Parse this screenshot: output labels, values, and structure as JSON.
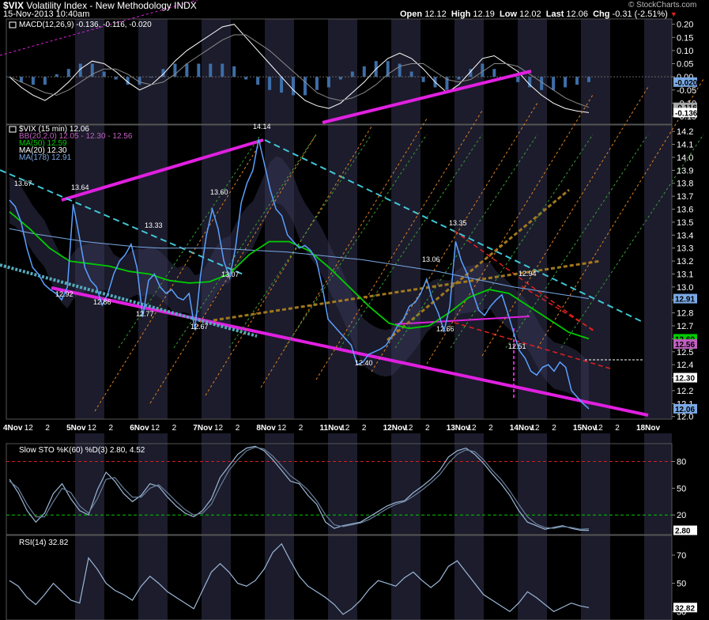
{
  "header": {
    "symbol": "$VIX",
    "name": "Volatility Index - New Methodology",
    "exchange": "INDX",
    "date": "15-Nov-2013 10:40am",
    "watermark": "© StockCharts.com",
    "open_label": "Open",
    "open": "12.12",
    "high_label": "High",
    "high": "12.19",
    "low_label": "Low",
    "low": "12.02",
    "last_label": "Last",
    "last": "12.06",
    "chg_label": "Chg",
    "chg": "-0.31 (-2.51%)"
  },
  "chart_data": [
    {
      "type": "line",
      "panel": "macd",
      "legend": "MACD(12,26,9) -0.136, -0.116, -0.020",
      "y_ticks": [
        "0.20",
        "0.15",
        "0.10",
        "0.05",
        "0.00",
        "-0.05",
        "-0.10",
        "-0.15"
      ],
      "ylim": [
        -0.18,
        0.22
      ],
      "last_tags": [
        {
          "value": -0.02,
          "label": "-0.020",
          "color": "#7aa9e6"
        },
        {
          "value": -0.116,
          "label": "-0.116",
          "color": "#aaaaaa"
        },
        {
          "value": -0.136,
          "label": "-0.136",
          "color": "#ffffff"
        }
      ],
      "series": [
        {
          "values": [
            0.0,
            -0.04,
            -0.07,
            -0.09,
            -0.06,
            -0.02,
            0.03,
            0.06,
            0.05,
            0.02,
            -0.02,
            -0.05,
            -0.03,
            0.01,
            0.06,
            0.1,
            0.13,
            0.16,
            0.19,
            0.2,
            0.15,
            0.1,
            0.05,
            0.0,
            -0.05,
            -0.09,
            -0.11,
            -0.12,
            -0.1,
            -0.06,
            -0.02,
            0.03,
            0.07,
            0.09,
            0.07,
            0.03,
            -0.02,
            -0.06,
            -0.03,
            0.02,
            0.07,
            0.08,
            0.05,
            0.02,
            -0.03,
            -0.07,
            -0.1,
            -0.12,
            -0.13,
            -0.136
          ],
          "color": "#ffffff"
        },
        {
          "values": [
            0.0,
            -0.02,
            -0.04,
            -0.06,
            -0.07,
            -0.05,
            -0.02,
            0.01,
            0.03,
            0.03,
            0.01,
            -0.02,
            -0.03,
            -0.02,
            0.01,
            0.05,
            0.08,
            0.11,
            0.14,
            0.16,
            0.16,
            0.13,
            0.1,
            0.06,
            0.02,
            -0.02,
            -0.06,
            -0.08,
            -0.09,
            -0.08,
            -0.06,
            -0.03,
            0.01,
            0.04,
            0.05,
            0.05,
            0.02,
            -0.01,
            -0.02,
            -0.01,
            0.02,
            0.05,
            0.05,
            0.04,
            0.01,
            -0.02,
            -0.05,
            -0.08,
            -0.1,
            -0.116
          ],
          "color": "#8a8a8a"
        }
      ]
    },
    {
      "type": "line",
      "panel": "price",
      "legend": [
        {
          "text": "$VIX (15 min) 12.06",
          "color": "#ffffff"
        },
        {
          "text": "BB(20,2.0) 12.05 - 12.30 - 12.56",
          "color": "#c060c0"
        },
        {
          "text": "MA(50) 12.59",
          "color": "#00cc00"
        },
        {
          "text": "MA(20) 12.30",
          "color": "#ffffff"
        },
        {
          "text": "MA(178) 12.91",
          "color": "#7aa9e6"
        }
      ],
      "y_ticks": [
        "14.2",
        "14.1",
        "14.0",
        "13.9",
        "13.8",
        "13.7",
        "13.6",
        "13.5",
        "13.4",
        "13.3",
        "13.2",
        "13.1",
        "13.0",
        "12.9",
        "12.8",
        "12.7",
        "12.6",
        "12.5",
        "12.4",
        "12.3",
        "12.2",
        "12.1",
        "12.0"
      ],
      "ylim": [
        11.98,
        14.25
      ],
      "last_tags": [
        {
          "value": 12.91,
          "label": "12.91",
          "color": "#7aa9e6"
        },
        {
          "value": 12.6,
          "label": "12.60",
          "color": "#00cc00"
        },
        {
          "value": 12.56,
          "label": "12.56",
          "color": "#c060c0"
        },
        {
          "value": 12.3,
          "label": "12.30",
          "color": "#ffffff"
        },
        {
          "value": 12.06,
          "label": "12.06",
          "color": "#7aa9e6"
        }
      ],
      "series": [
        {
          "name": "$VIX",
          "color": "#5aa0ff",
          "values": [
            13.67,
            13.62,
            13.5,
            13.3,
            13.15,
            13.1,
            13.02,
            12.98,
            12.95,
            12.9,
            13.0,
            13.64,
            13.4,
            13.15,
            13.05,
            13.0,
            12.86,
            12.95,
            13.1,
            13.2,
            13.25,
            13.33,
            13.15,
            12.77,
            13.05,
            13.1,
            13.0,
            12.95,
            12.98,
            12.92,
            12.9,
            12.95,
            12.67,
            13.1,
            13.4,
            13.6,
            13.45,
            13.2,
            13.07,
            13.3,
            13.65,
            13.8,
            13.9,
            14.14,
            13.95,
            13.75,
            13.6,
            13.55,
            13.4,
            13.35,
            13.3,
            13.32,
            13.28,
            13.2,
            13.0,
            12.75,
            12.7,
            12.65,
            12.6,
            12.55,
            12.4,
            12.42,
            12.48,
            12.5,
            12.52,
            12.55,
            12.62,
            12.7,
            12.75,
            12.85,
            12.88,
            12.95,
            13.06,
            12.9,
            12.8,
            12.66,
            12.85,
            13.35,
            13.2,
            13.1,
            12.95,
            12.82,
            12.78,
            12.85,
            12.9,
            12.94,
            12.8,
            12.65,
            12.51,
            12.45,
            12.35,
            12.32,
            12.38,
            12.4,
            12.35,
            12.42,
            12.38,
            12.2,
            12.15,
            12.1,
            12.06
          ]
        },
        {
          "name": "MA(178)",
          "color": "#7aa9e6",
          "values": [
            13.45,
            13.41,
            13.38,
            13.35,
            13.33,
            13.31,
            13.3,
            13.3,
            13.3,
            13.29,
            13.28,
            13.27,
            13.25,
            13.23,
            13.21,
            13.18,
            13.15,
            13.12,
            13.08,
            13.04,
            13.0,
            12.97,
            12.94,
            12.91
          ]
        },
        {
          "name": "MA(50)",
          "color": "#00cc00",
          "values": [
            13.58,
            13.45,
            13.3,
            13.2,
            13.18,
            13.16,
            13.12,
            13.1,
            13.05,
            13.03,
            13.04,
            13.1,
            13.25,
            13.35,
            13.35,
            13.28,
            13.15,
            13.0,
            12.85,
            12.72,
            12.68,
            12.7,
            12.8,
            12.92,
            12.98,
            12.95,
            12.85,
            12.75,
            12.65,
            12.6
          ]
        }
      ],
      "annotations": [
        "13.67",
        "13.64",
        "13.33",
        "12.86",
        "12.77",
        "12.67",
        "13.60",
        "13.07",
        "14.14",
        "12.40",
        "13.06",
        "12.66",
        "13.35",
        "12.94",
        "12.51",
        "12.92"
      ],
      "x_labels": [
        "4Nov",
        "12",
        "2",
        "5Nov",
        "12",
        "2",
        "6Nov",
        "12",
        "2",
        "7Nov",
        "12",
        "2",
        "8Nov",
        "12",
        "2",
        "11Nov",
        "12",
        "2",
        "12Nov",
        "12",
        "2",
        "13Nov",
        "12",
        "2",
        "14Nov",
        "12",
        "2",
        "15Nov",
        "12",
        "2",
        "18Nov"
      ]
    },
    {
      "type": "line",
      "panel": "stochastic",
      "legend": "Slow STO %K(60) %D(3) 2.80, 4.52",
      "y_ticks": [
        "80",
        "50",
        "20"
      ],
      "ylim": [
        -2,
        100
      ],
      "levels": [
        {
          "value": 80,
          "color": "#d32020"
        },
        {
          "value": 20,
          "color": "#00cc00"
        }
      ],
      "last_tags": [
        {
          "value": 2.8,
          "label": "2.80",
          "color": "#ffffff"
        }
      ],
      "series": [
        {
          "color": "#9bb8d8",
          "values": [
            60,
            45,
            25,
            12,
            22,
            44,
            55,
            38,
            25,
            20,
            48,
            68,
            58,
            44,
            35,
            42,
            55,
            52,
            40,
            30,
            22,
            18,
            25,
            38,
            62,
            75,
            88,
            95,
            97,
            92,
            82,
            70,
            58,
            55,
            42,
            32,
            12,
            5,
            8,
            10,
            12,
            18,
            24,
            30,
            34,
            36,
            45,
            52,
            60,
            70,
            85,
            92,
            95,
            88,
            78,
            66,
            55,
            42,
            25,
            12,
            8,
            4,
            6,
            8,
            5,
            3,
            2.8
          ]
        },
        {
          "color": "#6a7f99",
          "values": [
            58,
            50,
            32,
            18,
            18,
            35,
            50,
            45,
            30,
            22,
            38,
            60,
            62,
            50,
            40,
            40,
            50,
            54,
            45,
            35,
            26,
            20,
            22,
            32,
            52,
            70,
            82,
            92,
            96,
            94,
            86,
            75,
            64,
            57,
            48,
            36,
            20,
            9,
            7,
            9,
            11,
            15,
            21,
            27,
            32,
            35,
            41,
            48,
            56,
            65,
            78,
            88,
            93,
            91,
            82,
            70,
            60,
            47,
            32,
            18,
            10,
            6,
            5,
            7,
            6,
            4,
            4.52
          ]
        }
      ]
    },
    {
      "type": "line",
      "panel": "rsi",
      "legend": "RSI(14) 32.82",
      "y_ticks": [
        "70",
        "50",
        "30"
      ],
      "ylim": [
        24,
        84
      ],
      "last_tags": [
        {
          "value": 32.82,
          "label": "32.82",
          "color": "#ffffff"
        }
      ],
      "series": [
        {
          "color": "#9bb8d8",
          "values": [
            52,
            48,
            40,
            35,
            42,
            50,
            44,
            38,
            36,
            68,
            60,
            50,
            45,
            42,
            38,
            48,
            55,
            50,
            44,
            40,
            36,
            32,
            45,
            58,
            64,
            58,
            50,
            48,
            52,
            60,
            72,
            78,
            66,
            55,
            48,
            44,
            40,
            35,
            28,
            32,
            38,
            46,
            52,
            50,
            48,
            54,
            58,
            52,
            47,
            52,
            62,
            66,
            58,
            50,
            42,
            38,
            34,
            30,
            36,
            44,
            40,
            35,
            30,
            33,
            36,
            34,
            32.82
          ]
        }
      ]
    }
  ]
}
